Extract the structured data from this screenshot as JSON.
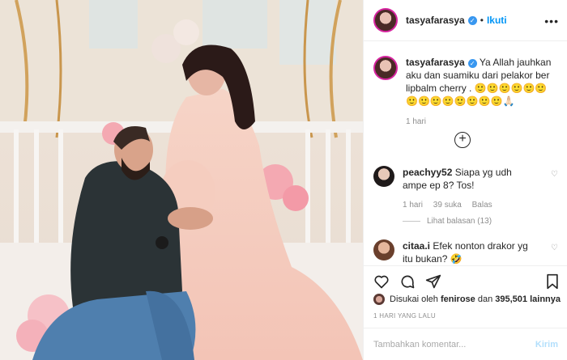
{
  "post": {
    "username": "tasyafarasya",
    "follow_label": "Ikuti",
    "more_icon": "ellipsis-icon"
  },
  "caption": {
    "username": "tasyafarasya",
    "text": "Ya Allah jauhkan aku dan suamiku dari pelakor ber lipbalm cherry . 🙂🙂🙂🙂🙂🙂🙂🙂🙂🙂🙂🙂🙂🙂🙏🏻",
    "time": "1 hari"
  },
  "comments": [
    {
      "username": "peachyy52",
      "text": "Siapa yg udh ampe ep 8? Tos!",
      "time": "1 hari",
      "likes": "39 suka",
      "reply": "Balas",
      "view_replies": "Lihat balasan (13)"
    },
    {
      "username": "citaa.i",
      "text": "Efek nonton drakor yg itu bukan? 🤣"
    }
  ],
  "likes": {
    "prefix": "Disukai oleh",
    "user": "fenirose",
    "joiner": "dan",
    "count": "395,501 lainnya"
  },
  "date_label": "1 HARI YANG LALU",
  "add_comment": {
    "placeholder": "Tambahkan komentar...",
    "post_label": "Kirim"
  },
  "colors": {
    "accent": "#0095f6",
    "verified": "#3897f0"
  }
}
